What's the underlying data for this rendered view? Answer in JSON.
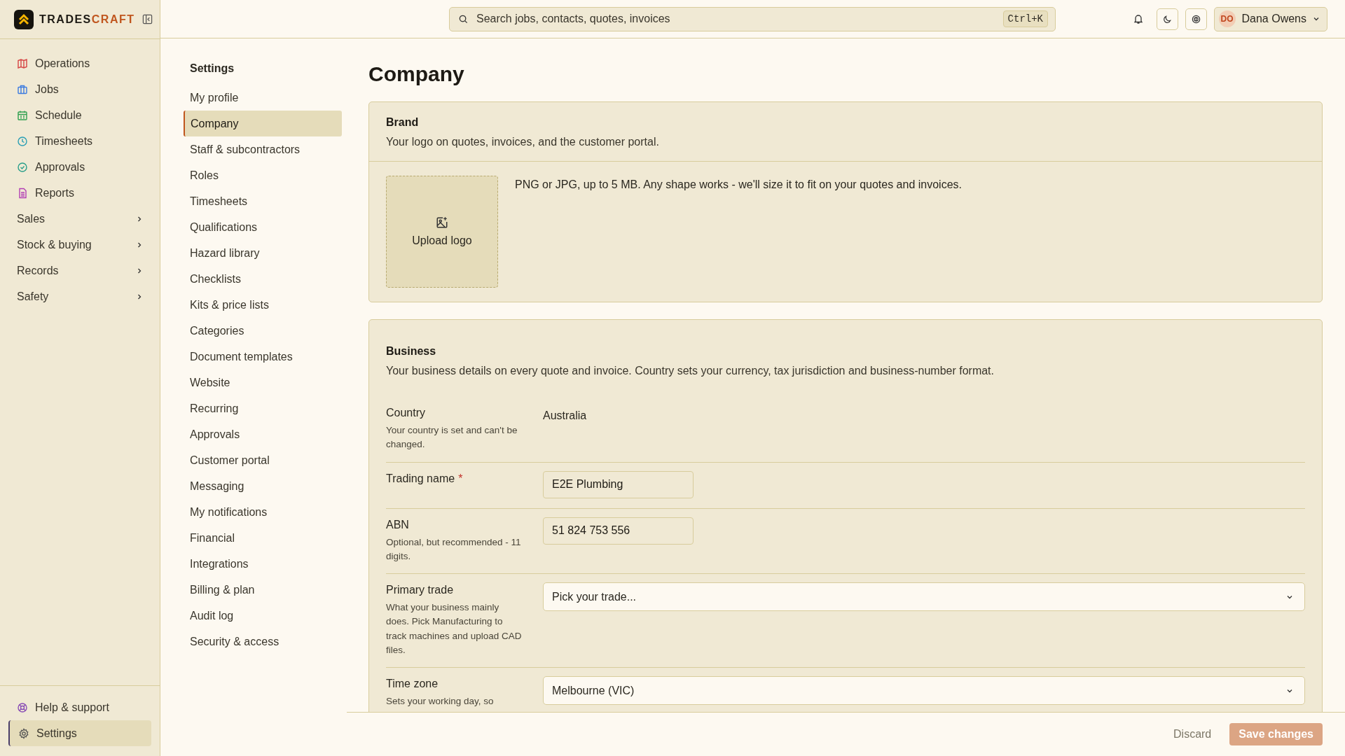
{
  "brand": {
    "name_parts": [
      "TRADES",
      "CRAFT"
    ]
  },
  "sidebar": {
    "items": [
      {
        "label": "Operations",
        "kind": "link",
        "selected": false
      },
      {
        "label": "Jobs",
        "kind": "link",
        "selected": false
      },
      {
        "label": "Schedule",
        "kind": "link",
        "selected": false
      },
      {
        "label": "Timesheets",
        "kind": "link",
        "selected": false
      },
      {
        "label": "Approvals",
        "kind": "link",
        "selected": false
      },
      {
        "label": "Reports",
        "kind": "link",
        "selected": false
      },
      {
        "label": "Sales",
        "kind": "group",
        "expanded": false
      },
      {
        "label": "Stock & buying",
        "kind": "group",
        "expanded": false
      },
      {
        "label": "Records",
        "kind": "group",
        "expanded": false
      },
      {
        "label": "Safety",
        "kind": "group",
        "expanded": false
      }
    ],
    "footer_items": [
      {
        "label": "Help & support",
        "selected": false
      },
      {
        "label": "Settings",
        "selected": true
      }
    ]
  },
  "topbar": {
    "search": {
      "placeholder": "Search jobs, contacts, quotes, invoices",
      "shortcut": "Ctrl+K"
    },
    "user": {
      "initials": "DO",
      "name": "Dana Owens"
    }
  },
  "settings_nav": {
    "title": "Settings",
    "items": [
      {
        "label": "My profile",
        "selected": false
      },
      {
        "label": "Company",
        "selected": true
      },
      {
        "label": "Staff & subcontractors",
        "selected": false
      },
      {
        "label": "Roles",
        "selected": false
      },
      {
        "label": "Timesheets",
        "selected": false
      },
      {
        "label": "Qualifications",
        "selected": false
      },
      {
        "label": "Hazard library",
        "selected": false
      },
      {
        "label": "Checklists",
        "selected": false
      },
      {
        "label": "Kits & price lists",
        "selected": false
      },
      {
        "label": "Categories",
        "selected": false
      },
      {
        "label": "Document templates",
        "selected": false
      },
      {
        "label": "Website",
        "selected": false
      },
      {
        "label": "Recurring",
        "selected": false
      },
      {
        "label": "Approvals",
        "selected": false
      },
      {
        "label": "Customer portal",
        "selected": false
      },
      {
        "label": "Messaging",
        "selected": false
      },
      {
        "label": "My notifications",
        "selected": false
      },
      {
        "label": "Financial",
        "selected": false
      },
      {
        "label": "Integrations",
        "selected": false
      },
      {
        "label": "Billing & plan",
        "selected": false
      },
      {
        "label": "Audit log",
        "selected": false
      },
      {
        "label": "Security & access",
        "selected": false
      }
    ]
  },
  "page": {
    "title": "Company",
    "brand_card": {
      "title": "Brand",
      "description": "Your logo on quotes, invoices, and the customer portal.",
      "upload_label": "Upload logo",
      "note": "PNG or JPG, up to 5 MB. Any shape works - we'll size it to fit on your quotes and invoices."
    },
    "business_card": {
      "title": "Business",
      "description": "Your business details on every quote and invoice. Country sets your currency, tax jurisdiction and business-number format.",
      "fields": [
        {
          "kind": "static",
          "label": "Country",
          "hint": "Your country is set and can't be changed.",
          "value": "Australia"
        },
        {
          "kind": "text",
          "label": "Trading name",
          "required_mark": "*",
          "value": "E2E Plumbing"
        },
        {
          "kind": "text",
          "label": "ABN",
          "hint": "Optional, but recommended - 11 digits.",
          "value": "51 824 753 556"
        },
        {
          "kind": "select",
          "label": "Primary trade",
          "hint": "What your business mainly does. Pick Manufacturing to track machines and upload CAD files.",
          "placeholder": "Pick your trade..."
        },
        {
          "kind": "select",
          "label": "Time zone",
          "hint": "Sets your working day, so",
          "value": "Melbourne (VIC)"
        }
      ]
    }
  },
  "footer": {
    "discard": "Discard",
    "save": {
      "label": "Save changes",
      "disabled": true
    }
  }
}
